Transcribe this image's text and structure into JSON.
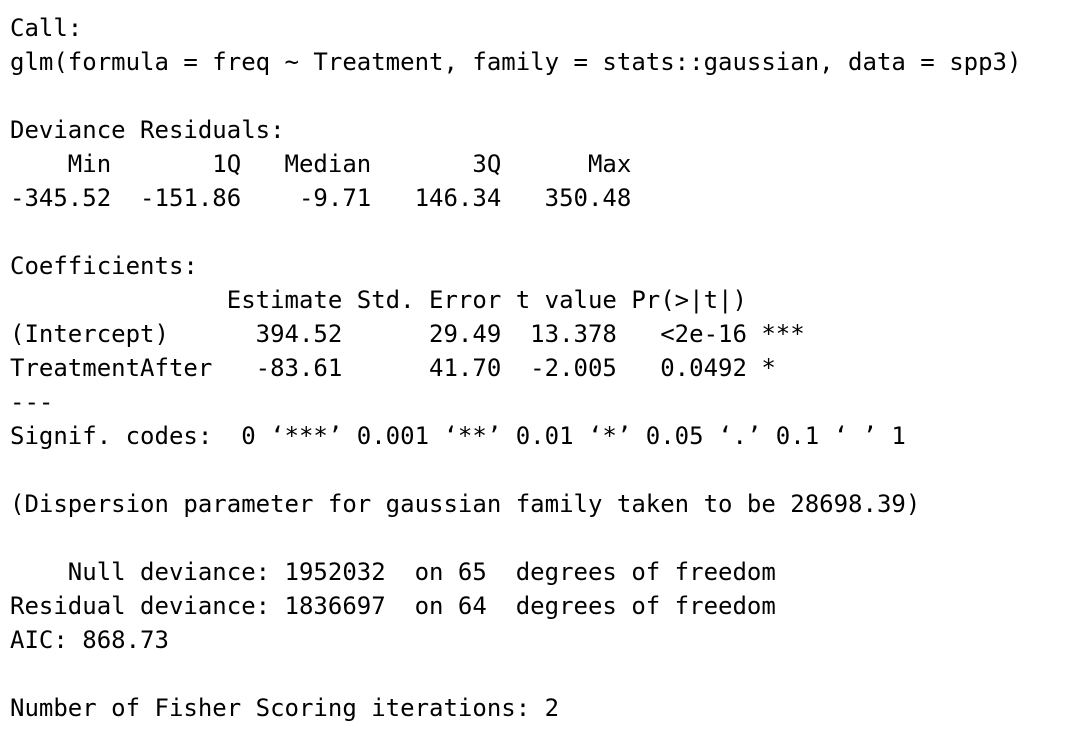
{
  "output": {
    "lines": [
      "Call:",
      "glm(formula = freq ~ Treatment, family = stats::gaussian, data = spp3)",
      "",
      "Deviance Residuals:",
      "    Min       1Q   Median       3Q      Max",
      "-345.52  -151.86    -9.71   146.34   350.48",
      "",
      "Coefficients:",
      "               Estimate Std. Error t value Pr(>|t|)",
      "(Intercept)      394.52      29.49  13.378   <2e-16 ***",
      "TreatmentAfter   -83.61      41.70  -2.005   0.0492 *",
      "---",
      "Signif. codes:  0 ‘***’ 0.001 ‘**’ 0.01 ‘*’ 0.05 ‘.’ 0.1 ‘ ’ 1",
      "",
      "(Dispersion parameter for gaussian family taken to be 28698.39)",
      "",
      "    Null deviance: 1952032  on 65  degrees of freedom",
      "Residual deviance: 1836697  on 64  degrees of freedom",
      "AIC: 868.73",
      "",
      "Number of Fisher Scoring iterations: 2"
    ]
  }
}
